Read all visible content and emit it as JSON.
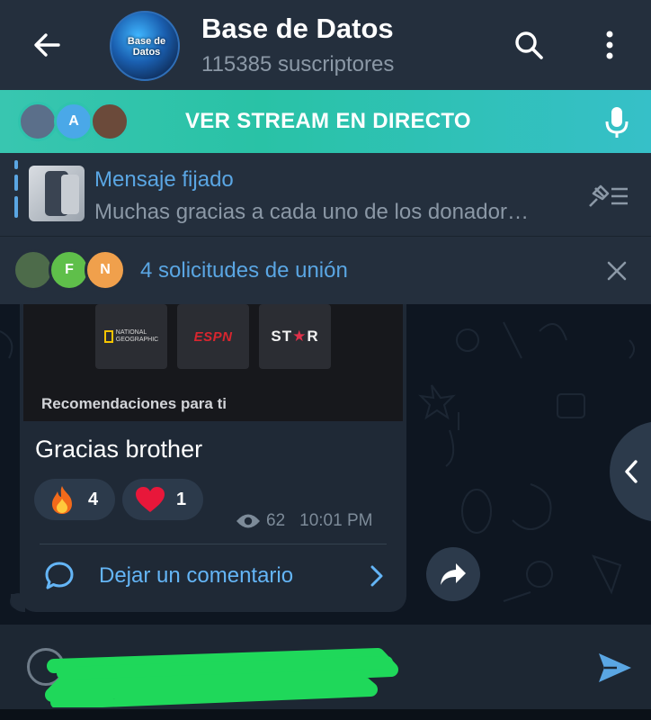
{
  "header": {
    "title": "Base de Datos",
    "subtitle": "115385 suscriptores",
    "avatar_text": "Base de Datos",
    "icons": [
      "back-arrow-icon",
      "search-icon",
      "more-vertical-icon"
    ]
  },
  "live_banner": {
    "label": "VER STREAM EN DIRECTO",
    "participants": [
      "",
      "A",
      ""
    ],
    "accent": "#2fc3ad",
    "icon": "microphone-icon"
  },
  "pinned": {
    "title": "Mensaje fijado",
    "text": "Muchas gracias a cada uno de los donador…",
    "icon": "pinned-list-icon"
  },
  "join_requests": {
    "avatars": [
      "",
      "F",
      "N"
    ],
    "label": "4 solicitudes de unión",
    "icon": "close-icon"
  },
  "message": {
    "media_tiles": [
      {
        "name": "NATIONAL GEOGRAPHIC",
        "line1": "NATIONAL",
        "line2": "GEOGRAPHIC"
      },
      {
        "name": "ESPN"
      },
      {
        "left": "ST",
        "mid": "★",
        "right": "R"
      }
    ],
    "media_caption": "Recomendaciones para ti",
    "text": "Gracias brother",
    "reactions": [
      {
        "emoji": "fire-icon",
        "count": "4"
      },
      {
        "emoji": "heart-icon",
        "count": "1"
      }
    ],
    "views": "62",
    "time": "10:01 PM",
    "comment_label": "Dejar un comentario"
  },
  "composer": {
    "placeholder": "",
    "value": "",
    "icons": [
      "emoji-icon",
      "send-icon"
    ]
  },
  "colors": {
    "header_bg": "#242f3d",
    "chat_bg": "#0e1621",
    "link_blue": "#5aa6e3",
    "banner_green": "#2fc3ad"
  }
}
